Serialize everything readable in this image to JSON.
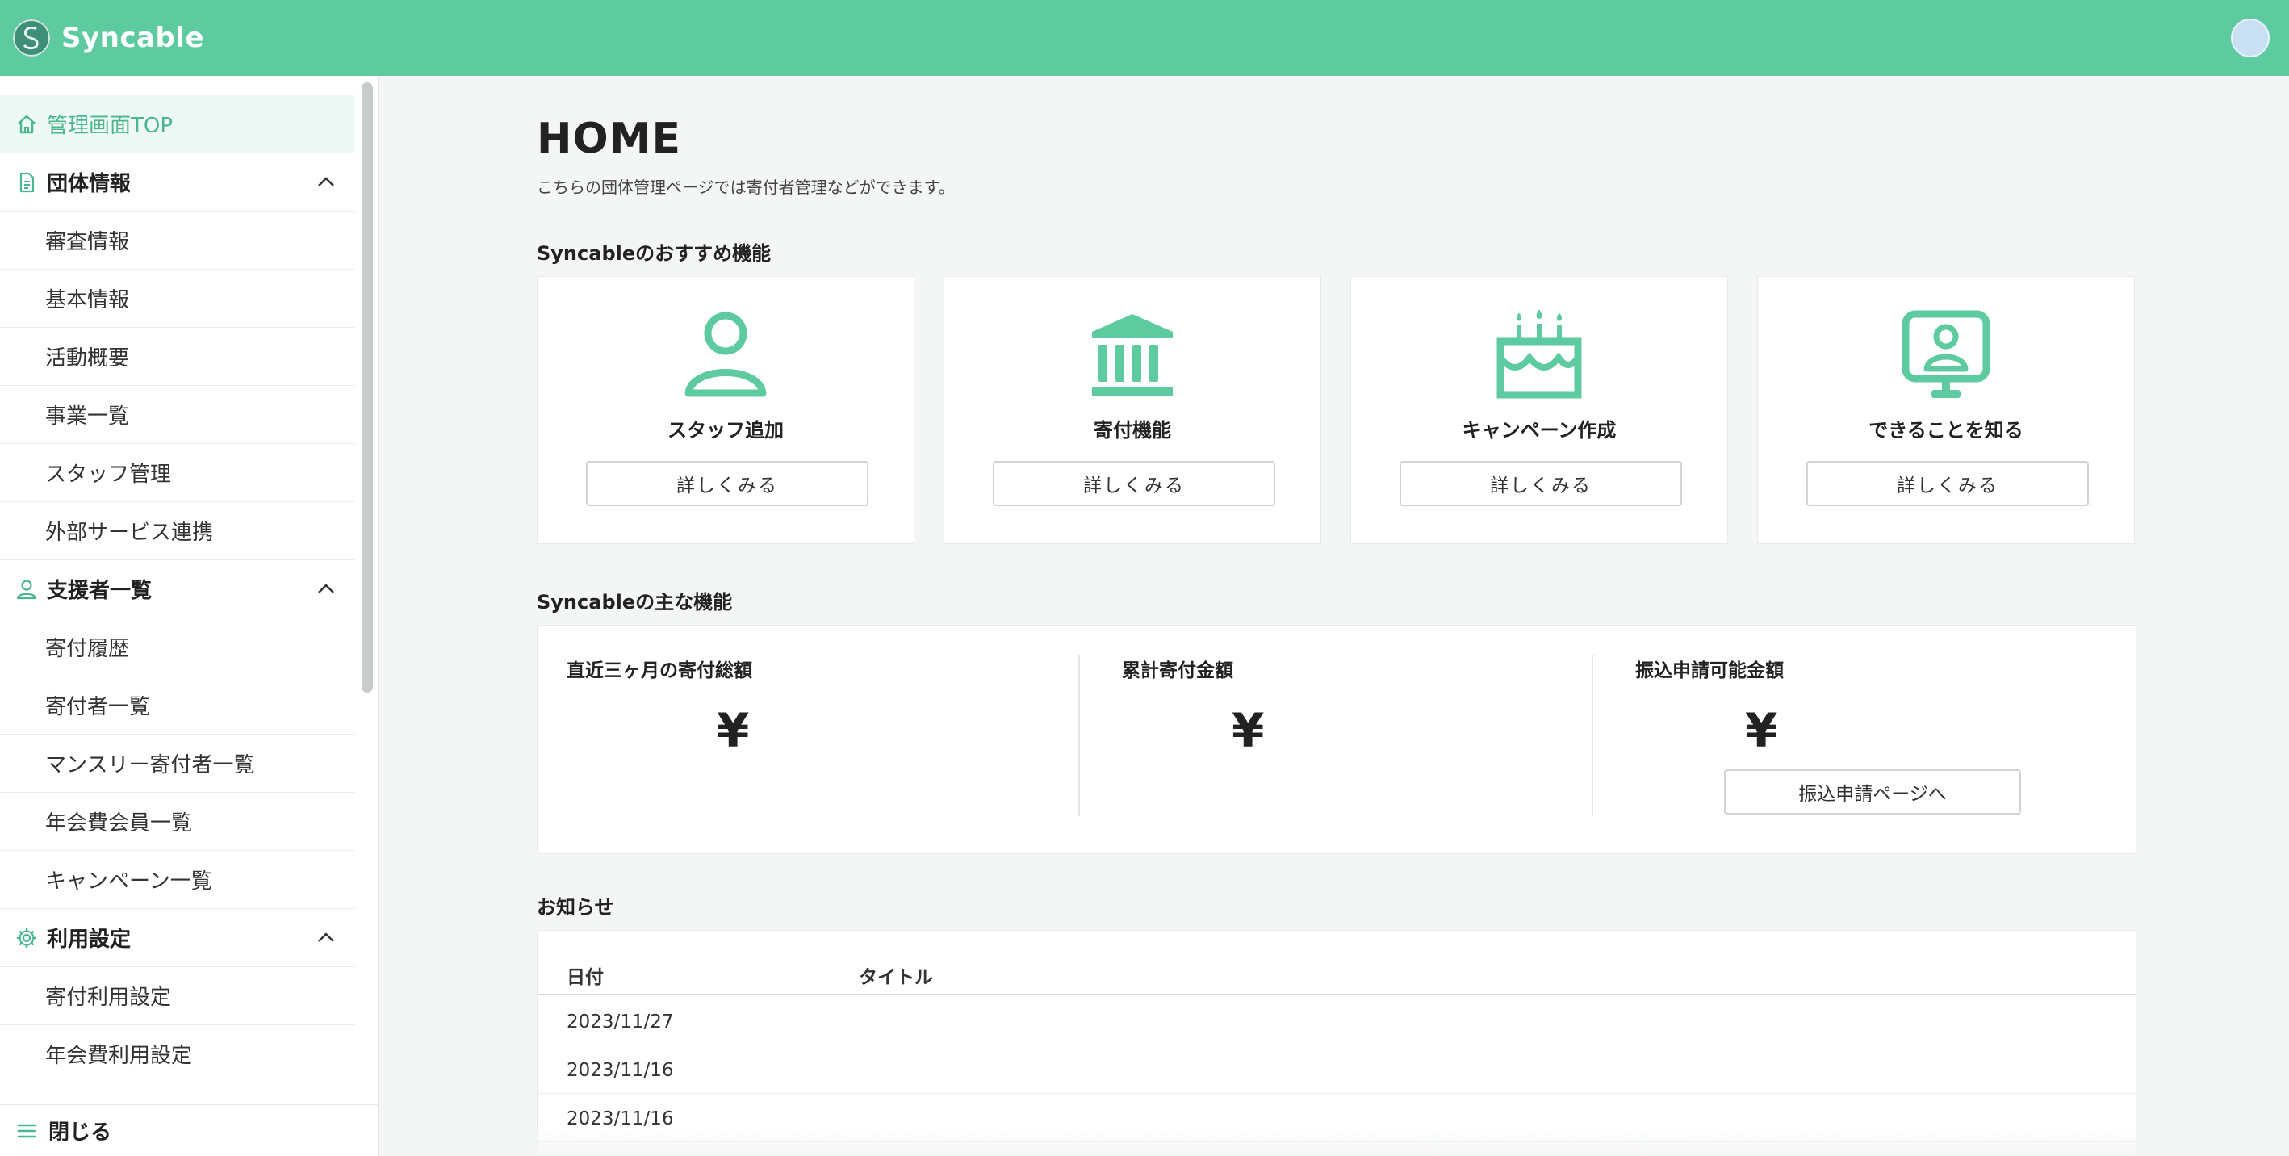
{
  "app": {
    "name": "Syncable"
  },
  "colors": {
    "brand": "#5dcaa0",
    "brand_dark": "#4cb78e",
    "background": "#f4f5f5"
  },
  "sidebar": {
    "top_item": {
      "label": "管理画面TOP",
      "icon": "home-icon"
    },
    "sections": [
      {
        "label": "団体情報",
        "icon": "document-icon",
        "items": [
          "審査情報",
          "基本情報",
          "活動概要",
          "事業一覧",
          "スタッフ管理",
          "外部サービス連携"
        ]
      },
      {
        "label": "支援者一覧",
        "icon": "person-icon",
        "items": [
          "寄付履歴",
          "寄付者一覧",
          "マンスリー寄付者一覧",
          "年会費会員一覧",
          "キャンペーン一覧"
        ]
      },
      {
        "label": "利用設定",
        "icon": "gear-icon",
        "items": [
          "寄付利用設定",
          "年会費利用設定"
        ]
      }
    ],
    "close_label": "閉じる"
  },
  "main": {
    "title": "HOME",
    "description": "こちらの団体管理ページでは寄付者管理などができます。",
    "recommend_title": "Syncableのおすすめ機能",
    "cards": [
      {
        "label": "スタッフ追加",
        "button": "詳しくみる",
        "icon": "staff-person-icon"
      },
      {
        "label": "寄付機能",
        "button": "詳しくみる",
        "icon": "institution-icon"
      },
      {
        "label": "キャンペーン作成",
        "button": "詳しくみる",
        "icon": "cake-icon"
      },
      {
        "label": "できることを知る",
        "button": "詳しくみる",
        "icon": "monitor-person-icon"
      }
    ],
    "features_title": "Syncableの主な機能",
    "stats": [
      {
        "label": "直近三ヶ月の寄付総額",
        "value": "¥"
      },
      {
        "label": "累計寄付金額",
        "value": "¥"
      },
      {
        "label": "振込申請可能金額",
        "value": "¥"
      }
    ],
    "transfer_button": "振込申請ページへ",
    "news_title": "お知らせ",
    "news_headers": {
      "date": "日付",
      "title": "タイトル"
    },
    "news_rows": [
      {
        "date": "2023/11/27"
      },
      {
        "date": "2023/11/16"
      },
      {
        "date": "2023/11/16"
      }
    ]
  }
}
